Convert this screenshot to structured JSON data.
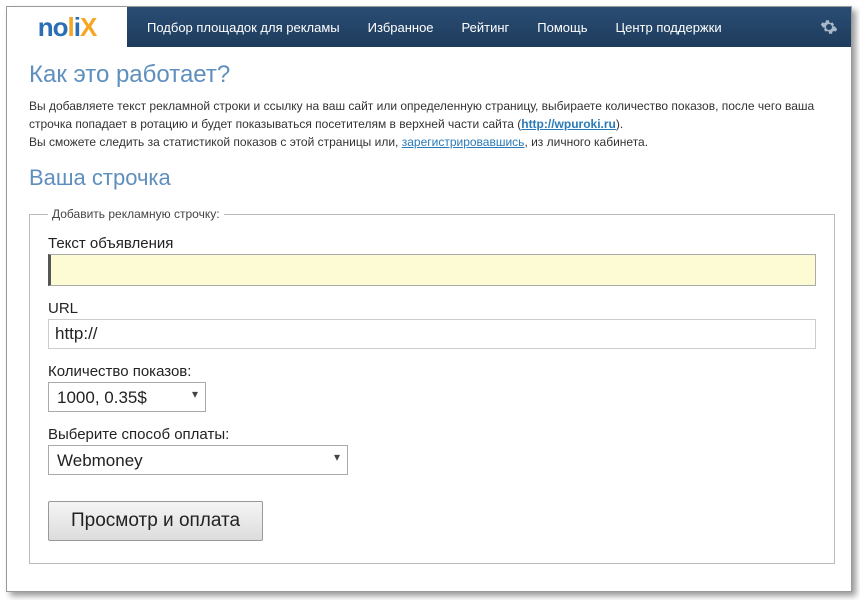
{
  "logo": {
    "part1": "no",
    "part2": "l",
    "part3": "i",
    "part4": "X"
  },
  "nav": {
    "items": [
      "Подбор площадок для рекламы",
      "Избранное",
      "Рейтинг",
      "Помощь",
      "Центр поддержки"
    ]
  },
  "section": {
    "how_title": "Как это работает?",
    "intro_part1": "Вы добавляете текст рекламной строки и ссылку на ваш сайт или определенную страницу, выбираете количество показов, после чего ваша строчка попадает в ротацию и будет показываться посетителям в верхней части сайта (",
    "intro_link": "http://wpuroki.ru",
    "intro_part2": ").",
    "intro_line2_a": "Вы сможете следить за статистикой показов с этой страницы или, ",
    "intro_reg_link": "зарегистрировавшись",
    "intro_line2_b": ", из личного кабинета.",
    "your_line_title": "Ваша строчка"
  },
  "form": {
    "legend": "Добавить рекламную строчку:",
    "ad_text_label": "Текст объявления",
    "ad_text_value": "",
    "url_label": "URL",
    "url_value": "http://",
    "count_label": "Количество показов:",
    "count_value": "1000, 0.35$",
    "payment_label": "Выберите способ оплаты:",
    "payment_value": "Webmoney",
    "submit_label": "Просмотр и оплата"
  }
}
